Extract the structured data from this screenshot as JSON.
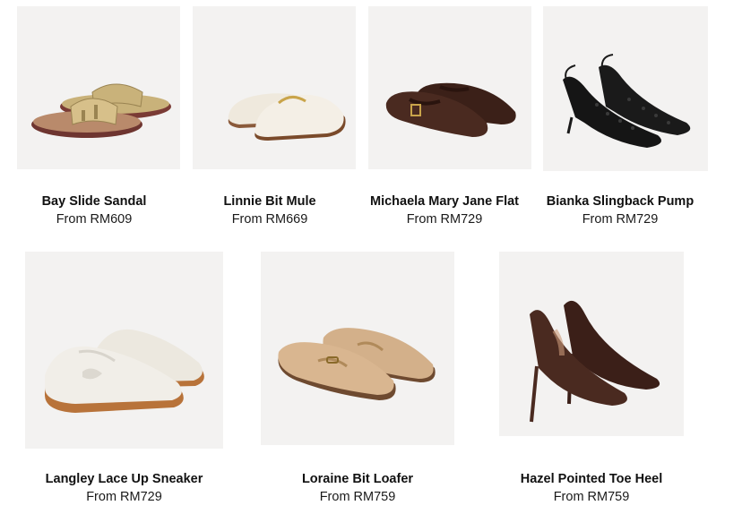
{
  "products": [
    {
      "name": "Bay Slide Sandal",
      "price": "From RM609",
      "image": "bay-slide-sandal-image"
    },
    {
      "name": "Linnie Bit Mule",
      "price": "From RM669",
      "image": "linnie-bit-mule-image"
    },
    {
      "name": "Michaela Mary Jane Flat",
      "price": "From RM729",
      "image": "michaela-mary-jane-flat-image"
    },
    {
      "name": "Bianka Slingback Pump",
      "price": "From RM729",
      "image": "bianka-slingback-pump-image"
    },
    {
      "name": "Langley Lace Up Sneaker",
      "price": "From RM729",
      "image": "langley-sneaker-image"
    },
    {
      "name": "Loraine Bit Loafer",
      "price": "From RM759",
      "image": "loraine-bit-loafer-image"
    },
    {
      "name": "Hazel Pointed Toe Heel",
      "price": "From RM759",
      "image": "hazel-heel-image"
    }
  ],
  "colors": {
    "photo_bg": "#f3f2f1",
    "gold": "#c9b27a",
    "cream": "#efe9dd",
    "brown": "#4a2a20",
    "black": "#151515",
    "tan": "#d3b08a",
    "gum": "#b8733a"
  }
}
